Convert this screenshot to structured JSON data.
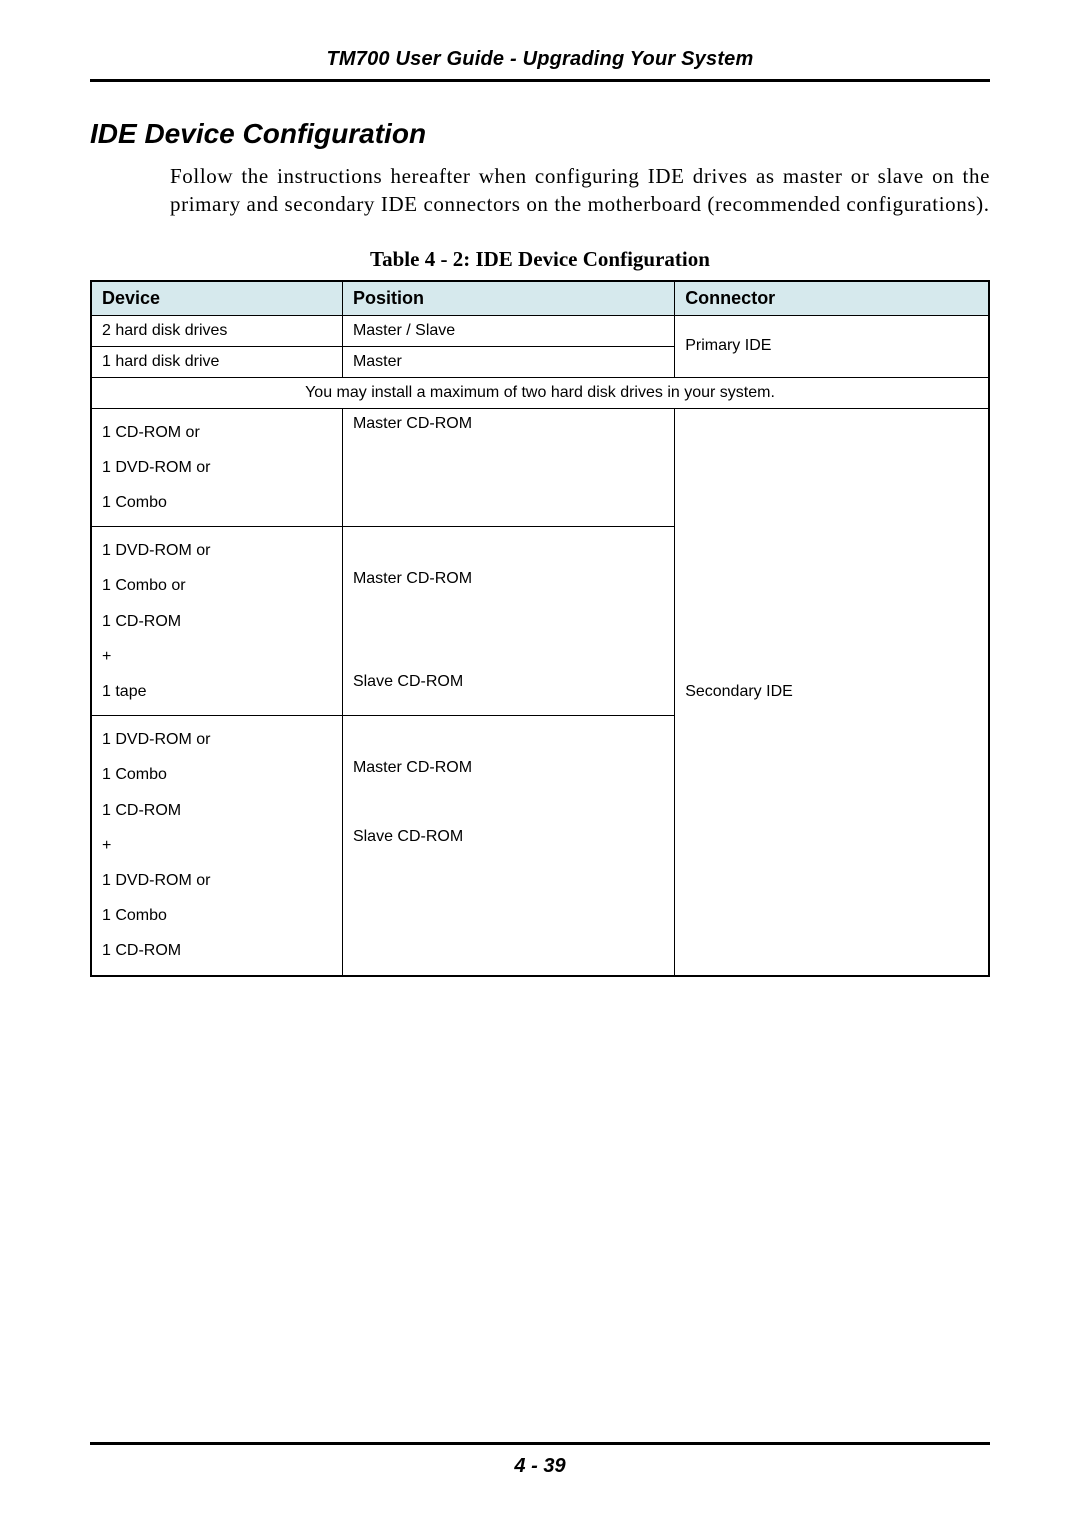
{
  "header": {
    "running_head": "TM700 User Guide - Upgrading Your System"
  },
  "section": {
    "title": "IDE Device Configuration",
    "intro": "Follow the instructions hereafter when configuring IDE drives as master or slave on the primary and secondary IDE connectors on the motherboard (recommended configurations)."
  },
  "table": {
    "caption": "Table 4 - 2: IDE Device Configuration",
    "headers": {
      "device": "Device",
      "position": "Position",
      "connector": "Connector"
    },
    "rows": {
      "r1": {
        "device": "2 hard disk drives",
        "position": "Master / Slave"
      },
      "r2": {
        "device": "1 hard disk drive",
        "position": "Master"
      },
      "primary_connector": "Primary IDE",
      "note": "You may install a maximum of two hard disk drives in your system.",
      "r3": {
        "device": "1 CD-ROM or\n1 DVD-ROM or\n1 Combo",
        "position": "Master CD-ROM"
      },
      "r4": {
        "device": "1 DVD-ROM or\n1 Combo or\n1 CD-ROM\n+\n1 tape",
        "position_top": "Master CD-ROM",
        "position_bottom": "Slave CD-ROM"
      },
      "r5": {
        "device": "1 DVD-ROM or\n1 Combo\n1 CD-ROM\n+\n1 DVD-ROM or\n1 Combo\n1 CD-ROM",
        "position_top": "Master CD-ROM",
        "position_bottom": "Slave CD-ROM"
      },
      "secondary_connector": "Secondary IDE"
    }
  },
  "footer": {
    "page_number": "4 - 39"
  }
}
